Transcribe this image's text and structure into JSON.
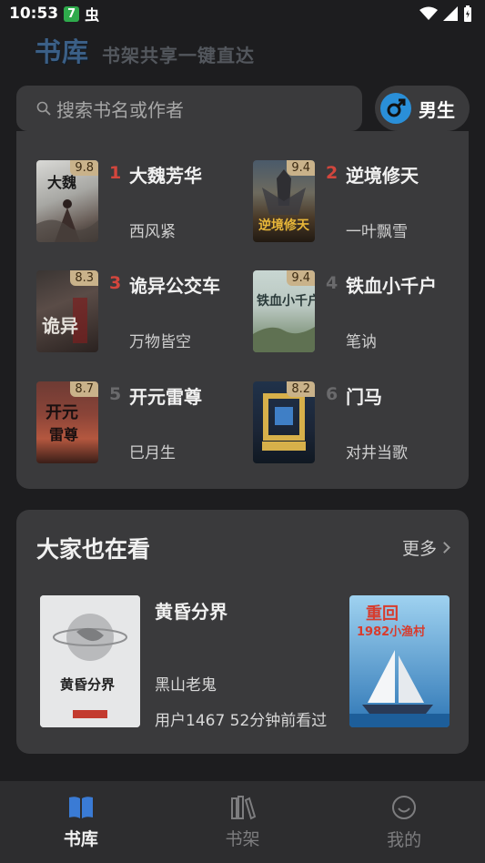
{
  "status_bar": {
    "time": "10:53",
    "badge": "7",
    "bug": "虫"
  },
  "header": {
    "title": "书库",
    "subtitle": "书架共享一键直达"
  },
  "search": {
    "placeholder": "搜索书名或作者"
  },
  "gender": {
    "label": "男生",
    "color": "#2a8fd8"
  },
  "ranking": [
    {
      "rank": "1",
      "title": "大魏芳华",
      "author": "西风紧",
      "score": "9.8",
      "cover_text": "大魏芳华"
    },
    {
      "rank": "2",
      "title": "逆境修天",
      "author": "一叶飘雪",
      "score": "9.4",
      "cover_text": "逆境修天"
    },
    {
      "rank": "3",
      "title": "诡异公交车",
      "author": "万物皆空",
      "score": "8.3",
      "cover_text": "诡异"
    },
    {
      "rank": "4",
      "title": "铁血小千户",
      "author": "笔讷",
      "score": "9.4",
      "cover_text": "铁血小千户"
    },
    {
      "rank": "5",
      "title": "开元雷尊",
      "author": "巳月生",
      "score": "8.7",
      "cover_text": "开元雷尊"
    },
    {
      "rank": "6",
      "title": "门马",
      "author": "对井当歌",
      "score": "8.2",
      "cover_text": "门"
    }
  ],
  "also_reading": {
    "title": "大家也在看",
    "more": "更多",
    "book": {
      "title": "黄昏分界",
      "author": "黑山老鬼",
      "meta": "用户1467 52分钟前看过",
      "cover_text": "黄昏分界"
    },
    "next_cover_text": "重回1982小渔村"
  },
  "nav": [
    {
      "label": "书库",
      "active": true
    },
    {
      "label": "书架",
      "active": false
    },
    {
      "label": "我的",
      "active": false
    }
  ]
}
